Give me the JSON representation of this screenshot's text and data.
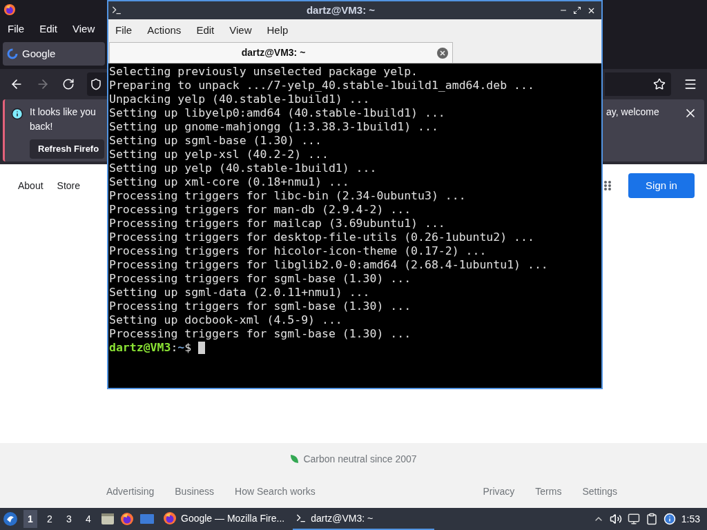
{
  "browser": {
    "menu": [
      {
        "label": "File"
      },
      {
        "label": "Edit"
      },
      {
        "label": "View"
      }
    ],
    "tab": {
      "title": "Google",
      "selected": true
    },
    "nav": {
      "back_disabled": false,
      "forward_disabled": true
    },
    "notification": {
      "text_start": "It looks like you",
      "text_end": "ay, welcome",
      "text_line2": "back!",
      "button": "Refresh Firefo"
    },
    "page": {
      "header_links": [
        "About",
        "Store"
      ],
      "sign_in": "Sign in",
      "footer": {
        "carbon": "Carbon neutral since 2007",
        "left_links": [
          "Advertising",
          "Business",
          "How Search works"
        ],
        "right_links": [
          "Privacy",
          "Terms",
          "Settings"
        ]
      }
    }
  },
  "terminal": {
    "title": "dartz@VM3: ~",
    "menu": [
      "File",
      "Actions",
      "Edit",
      "View",
      "Help"
    ],
    "tab": {
      "title": "dartz@VM3: ~",
      "selected": true
    },
    "lines": [
      "Selecting previously unselected package yelp.",
      "Preparing to unpack .../7-yelp_40.stable-1build1_amd64.deb ...",
      "Unpacking yelp (40.stable-1build1) ...",
      "Setting up libyelp0:amd64 (40.stable-1build1) ...",
      "Setting up gnome-mahjongg (1:3.38.3-1build1) ...",
      "Setting up sgml-base (1.30) ...",
      "Setting up yelp-xsl (40.2-2) ...",
      "Setting up yelp (40.stable-1build1) ...",
      "Setting up xml-core (0.18+nmu1) ...",
      "Processing triggers for libc-bin (2.34-0ubuntu3) ...",
      "Processing triggers for man-db (2.9.4-2) ...",
      "Processing triggers for mailcap (3.69ubuntu1) ...",
      "Processing triggers for desktop-file-utils (0.26-1ubuntu2) ...",
      "Processing triggers for hicolor-icon-theme (0.17-2) ...",
      "Processing triggers for libglib2.0-0:amd64 (2.68.4-1ubuntu1) ...",
      "Processing triggers for sgml-base (1.30) ...",
      "Setting up sgml-data (2.0.11+nmu1) ...",
      "Processing triggers for sgml-base (1.30) ...",
      "Setting up docbook-xml (4.5-9) ...",
      "Processing triggers for sgml-base (1.30) ..."
    ],
    "prompt": {
      "user_host": "dartz@VM3",
      "separator": ":",
      "path": "~",
      "symbol": "$"
    }
  },
  "taskbar": {
    "workspaces": [
      {
        "label": "1",
        "selected": true
      },
      {
        "label": "2",
        "selected": false
      },
      {
        "label": "3",
        "selected": false
      },
      {
        "label": "4",
        "selected": false
      }
    ],
    "tasks": [
      {
        "label": "Google — Mozilla Fire...",
        "kind": "browser",
        "selected": false
      },
      {
        "label": "dartz@VM3: ~",
        "kind": "terminal",
        "selected": true
      }
    ],
    "clock": "1:53"
  }
}
